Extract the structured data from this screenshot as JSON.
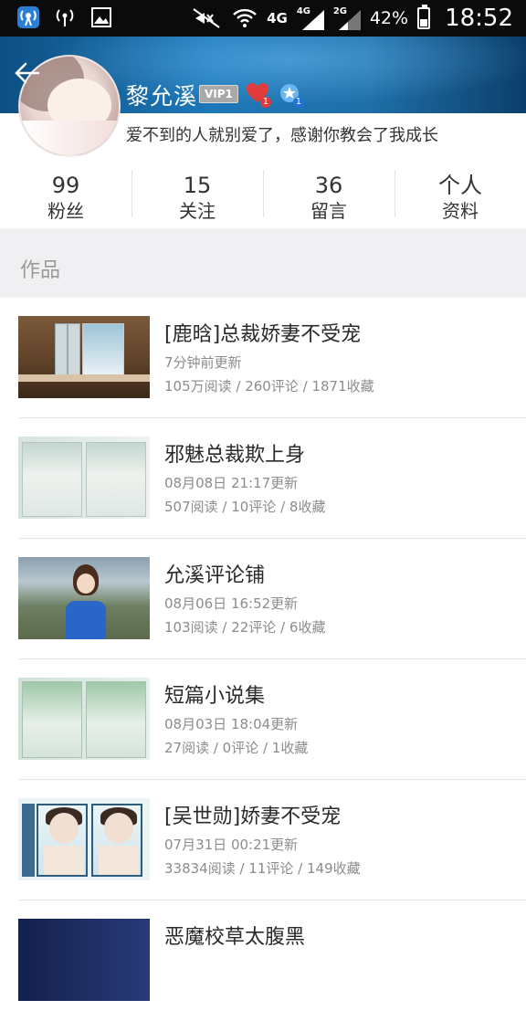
{
  "status_bar": {
    "icons_left": [
      "signal-tower-app-icon",
      "hotspot-icon",
      "gallery-icon"
    ],
    "network_4g": "4G",
    "net_4g_small": "4G",
    "net_2g_small": "2G",
    "battery": "42%",
    "battery_level": 0.42,
    "time": "18:52"
  },
  "profile": {
    "username": "黎允溪",
    "vip_label": "VIP1",
    "heart_count": "1",
    "star_count": "1",
    "signature": "爱不到的人就别爱了，感谢你教会了我成长"
  },
  "stats": [
    {
      "num": "99",
      "label": "粉丝"
    },
    {
      "num": "15",
      "label": "关注"
    },
    {
      "num": "36",
      "label": "留言"
    },
    {
      "num": "个人",
      "label": "资料"
    }
  ],
  "section": {
    "title": "作品"
  },
  "works": [
    {
      "title": "[鹿晗]总裁娇妻不受宠",
      "updated": "7分钟前更新",
      "counts": "105万阅读 / 260评论 / 1871收藏"
    },
    {
      "title": "邪魅总裁欺上身",
      "updated": "08月08日 21:17更新",
      "counts": "507阅读 / 10评论 / 8收藏"
    },
    {
      "title": "允溪评论铺",
      "updated": "08月06日 16:52更新",
      "counts": "103阅读 / 22评论 / 6收藏"
    },
    {
      "title": "短篇小说集",
      "updated": "08月03日 18:04更新",
      "counts": "27阅读 / 0评论 / 1收藏"
    },
    {
      "title": "[吴世勋]娇妻不受宠",
      "updated": "07月31日 00:21更新",
      "counts": "33834阅读 / 11评论 / 149收藏"
    },
    {
      "title": "恶魔校草太腹黑",
      "updated": "",
      "counts": ""
    }
  ],
  "colors": {
    "header_blue": "#1d78b8",
    "section_bg": "#f0f0f2",
    "meta_gray": "#8c8c8c"
  }
}
